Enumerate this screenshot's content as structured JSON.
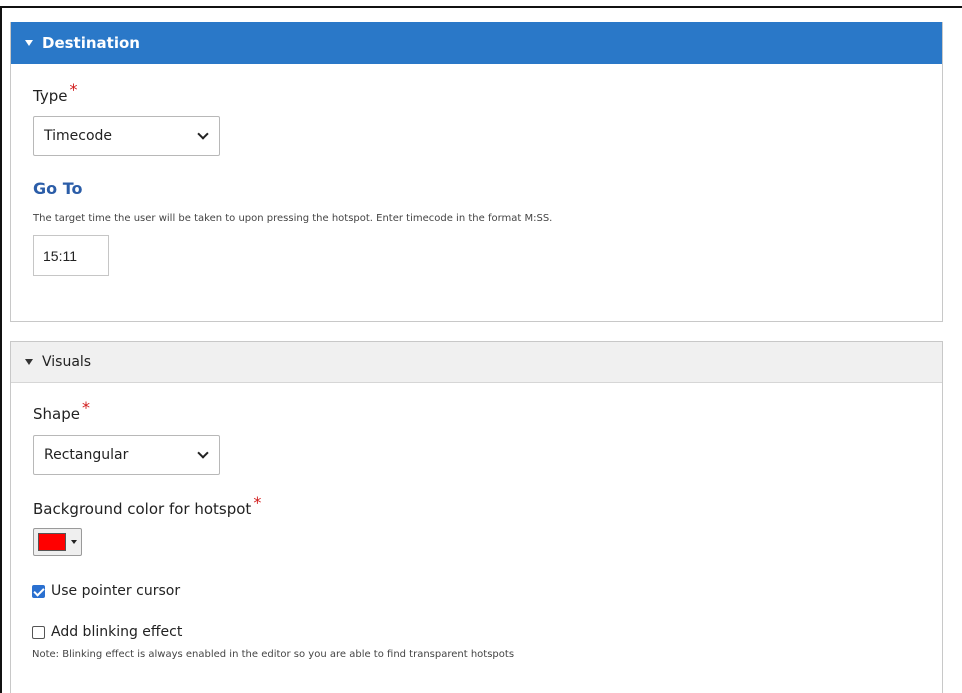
{
  "destination": {
    "header_label": "Destination",
    "type_label": "Type",
    "type_required": "*",
    "type_value": "Timecode",
    "goto_title": "Go To",
    "goto_description": "The target time the user will be taken to upon pressing the hotspot. Enter timecode in the format M:SS.",
    "goto_value": "15:11"
  },
  "visuals": {
    "header_label": "Visuals",
    "shape_label": "Shape",
    "shape_required": "*",
    "shape_value": "Rectangular",
    "bg_color_label": "Background color for hotspot",
    "bg_color_required": "*",
    "bg_color": "#ff0000",
    "pointer_cursor_label": "Use pointer cursor",
    "pointer_cursor_checked": true,
    "blinking_label": "Add blinking effect",
    "blinking_checked": false,
    "blinking_note": "Note: Blinking effect is always enabled in the editor so you are able to find transparent hotspots"
  },
  "colors": {
    "accent": "#2a78c8",
    "link_title": "#2b5da8",
    "required": "#d11a1a"
  },
  "icons": {
    "collapse_expanded": "caret-down-icon",
    "select_chevron": "chevron-down-icon"
  }
}
